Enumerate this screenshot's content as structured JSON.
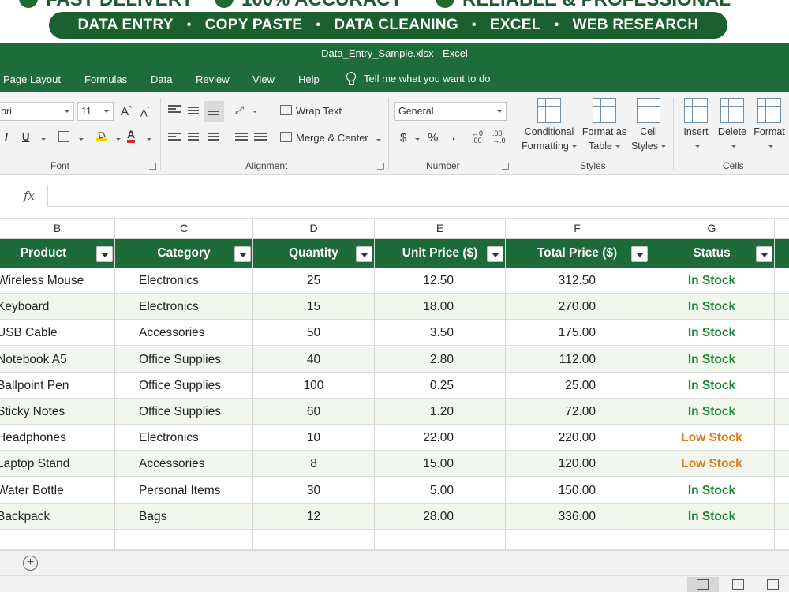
{
  "promo": {
    "top_items": [
      "FAST DELIVERY",
      "100% ACCURACY",
      "RELIABLE & PROFESSIONAL"
    ],
    "pill_items": [
      "DATA ENTRY",
      "COPY PASTE",
      "DATA CLEANING",
      "EXCEL",
      "WEB RESEARCH"
    ],
    "separator": "•"
  },
  "window": {
    "title": "Data_Entry_Sample.xlsx  -  Excel"
  },
  "menu": {
    "tabs": [
      "Page Layout",
      "Formulas",
      "Data",
      "Review",
      "View",
      "Help"
    ],
    "tell_me": "Tell me what you want to do"
  },
  "ribbon": {
    "font": {
      "name": "bri",
      "size": "11",
      "group": "Font"
    },
    "alignment": {
      "wrap_text": "Wrap Text",
      "merge_center": "Merge & Center",
      "group": "Alignment"
    },
    "number": {
      "format": "General",
      "currency": "$",
      "percent": "%",
      "comma": " ,",
      "group": "Number"
    },
    "styles": {
      "conditional": [
        "Conditional",
        "Formatting"
      ],
      "format_table": [
        "Format as",
        "Table"
      ],
      "cell_styles": [
        "Cell",
        "Styles"
      ],
      "group": "Styles"
    },
    "cells": {
      "insert": "Insert",
      "delete": "Delete",
      "format": "Format",
      "group": "Cells"
    }
  },
  "formula_bar": {
    "fx": "fx",
    "content": ""
  },
  "grid": {
    "column_letters": [
      "B",
      "C",
      "D",
      "E",
      "F",
      "G"
    ],
    "headers": [
      "Product",
      "Category",
      "Quantity",
      "Unit Price ($)",
      "Total Price ($)",
      "Status"
    ],
    "rows": [
      [
        "Wireless Mouse",
        "Electronics",
        "25",
        "12.50",
        "312.50",
        "In Stock"
      ],
      [
        "Keyboard",
        "Electronics",
        "15",
        "18.00",
        "270.00",
        "In Stock"
      ],
      [
        "USB Cable",
        "Accessories",
        "50",
        "3.50",
        "175.00",
        "In Stock"
      ],
      [
        "Notebook A5",
        "Office Supplies",
        "40",
        "2.80",
        "112.00",
        "In Stock"
      ],
      [
        "Ballpoint Pen",
        "Office Supplies",
        "100",
        "0.25",
        "25.00",
        "In Stock"
      ],
      [
        "Sticky Notes",
        "Office Supplies",
        "60",
        "1.20",
        "72.00",
        "In Stock"
      ],
      [
        "Headphones",
        "Electronics",
        "10",
        "22.00",
        "220.00",
        "Low Stock"
      ],
      [
        "Laptop Stand",
        "Accessories",
        "8",
        "15.00",
        "120.00",
        "Low Stock"
      ],
      [
        "Water Bottle",
        "Personal Items",
        "30",
        "5.00",
        "150.00",
        "In Stock"
      ],
      [
        "Backpack",
        "Bags",
        "12",
        "28.00",
        "336.00",
        "In Stock"
      ]
    ]
  },
  "sheet_bar": {
    "add_sheet": "+"
  },
  "colors": {
    "excel_green": "#1e6b3b",
    "header_green": "#1d6b38",
    "in_stock": "#1f8a34",
    "low_stock": "#e07a12"
  }
}
